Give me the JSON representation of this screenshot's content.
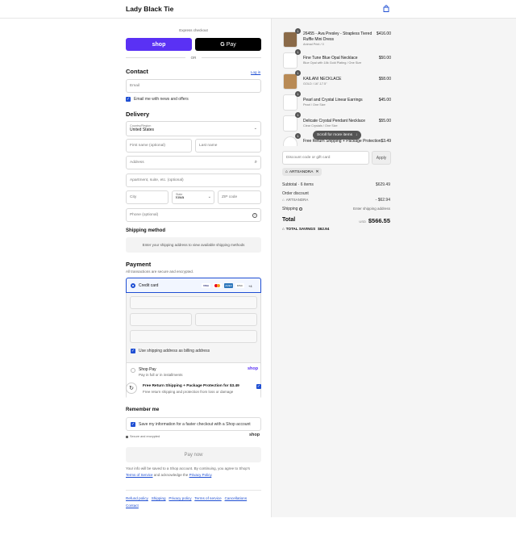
{
  "header": {
    "brand": "Lady Black Tie",
    "bag_icon": "shopping-bag-icon"
  },
  "express": {
    "label": "Express checkout",
    "shop_label": "shop",
    "gpay_label": "Pay",
    "or_label": "OR",
    "shop_color": "#5a31f4"
  },
  "contact": {
    "title": "Contact",
    "login_label": "Log in",
    "email_placeholder": "Email",
    "news_label": "Email me with news and offers"
  },
  "delivery": {
    "title": "Delivery",
    "country_label": "Country/Region",
    "country_value": "United States",
    "first_name_placeholder": "First name (optional)",
    "last_name_placeholder": "Last name",
    "address_placeholder": "Address",
    "apartment_placeholder": "Apartment, suite, etc. (optional)",
    "city_placeholder": "City",
    "state_label": "State",
    "state_value": "Iowa",
    "zip_placeholder": "ZIP code",
    "phone_placeholder": "Phone (optional)"
  },
  "shipping_method": {
    "title": "Shipping method",
    "note": "Enter your shipping address to view available shipping methods"
  },
  "payment": {
    "title": "Payment",
    "subtitle": "All transactions are secure and encrypted.",
    "credit_card_label": "Credit card",
    "cards": [
      "VISA",
      "MC",
      "AMEX",
      "DISC"
    ],
    "more_cards": "+4",
    "billing_label": "Use shipping address as billing address",
    "shop_pay_label": "Shop Pay",
    "shop_pay_sub": "Pay in full or in installments",
    "shop_pay_logo": "shop"
  },
  "protection": {
    "title": "Free Return Shipping + Package Protection for $3.49",
    "subtitle": "Free return shipping and protection from loss or damage"
  },
  "remember": {
    "title": "Remember me",
    "save_label": "Save my information for a faster checkout with a Shop account",
    "secure_label": "Secure and encrypted",
    "shop_logo": "shop"
  },
  "pay_button": "Pay now",
  "legal": {
    "text1": "Your info will be saved to a Shop account. By continuing, you agree to Shop's",
    "terms": "Terms of Service",
    "text2": "and acknowledge the",
    "privacy": "Privacy Policy",
    "end": "."
  },
  "footer_links": [
    "Refund policy",
    "Shipping",
    "Privacy policy",
    "Terms of service",
    "Cancellations",
    "Contact"
  ],
  "cart": {
    "items": [
      {
        "qty": "1",
        "name": "26455 - Ava Presley - Strapless Tiered",
        "name2": "Ruffle Mini Dress",
        "variant": "Animal Print / 0",
        "price": "$416.00",
        "color": "#8a6a48"
      },
      {
        "qty": "1",
        "name": "Fine Tune Blue Opal Necklace",
        "name2": "",
        "variant": "Blue Opal with 18k Gold Plating / One Size",
        "price": "$50.00",
        "color": "#d8d8d8"
      },
      {
        "qty": "1",
        "name": "KAILANI NECKLACE",
        "name2": "",
        "variant": "GOLD / 16\"-17.5\"",
        "price": "$58.00",
        "color": "#b88a55"
      },
      {
        "qty": "1",
        "name": "Pearl and Crystal Linear Earrings",
        "name2": "",
        "variant": "Pearl / One Size",
        "price": "$45.00",
        "color": "#e3e3e3"
      },
      {
        "qty": "1",
        "name": "Delicate Crystal Pendant Necklace",
        "name2": "",
        "variant": "Clear Crystals / One Size",
        "price": "$55.00",
        "color": "#dcdcdc"
      },
      {
        "qty": "1",
        "name": "Free Return Shipping + Package Protection",
        "name2": "",
        "variant": "",
        "price": "$3.49",
        "color": "#fff"
      }
    ],
    "scroll_hint": "Scroll for more items",
    "discount_placeholder": "Discount code or gift card",
    "apply_label": "Apply",
    "code_tag": "ARTSANDRA",
    "subtotal_label": "Subtotal · 6 items",
    "subtotal_value": "$629.49",
    "order_discount_label": "Order discount",
    "discount_code": "ARTSANDRA",
    "discount_value": "- $62.94",
    "shipping_label": "Shipping",
    "shipping_value": "Enter shipping address",
    "total_label": "Total",
    "currency": "USD",
    "total_value": "$566.55",
    "savings_label": "TOTAL SAVINGS",
    "savings_value": "$62.94"
  }
}
